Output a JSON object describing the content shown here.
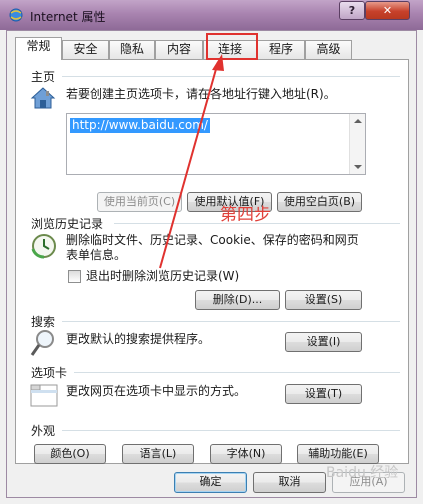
{
  "window": {
    "title": "Internet 属性",
    "help_button": "?",
    "close_button": "✕"
  },
  "tabs": [
    "常规",
    "安全",
    "隐私",
    "内容",
    "连接",
    "程序",
    "高级"
  ],
  "active_tab": "常规",
  "highlighted_tab": "连接",
  "sections": {
    "home": {
      "title": "主页",
      "description": "若要创建主页选项卡，请在各地址行键入地址(R)。",
      "url": "http://www.baidu.com/",
      "buttons": [
        "使用当前页(C)",
        "使用默认值(F)",
        "使用空白页(B)"
      ]
    },
    "history": {
      "title": "浏览历史记录",
      "description_line1": "删除临时文件、历史记录、Cookie、保存的密码和网页",
      "description_line2": "表单信息。",
      "checkbox_label": "退出时删除浏览历史记录(W)",
      "checkbox_checked": false,
      "delete_button": "删除(D)...",
      "settings_button": "设置(S)"
    },
    "search": {
      "title": "搜索",
      "description": "更改默认的搜索提供程序。",
      "settings_button": "设置(I)"
    },
    "tabs_section": {
      "title": "选项卡",
      "description": "更改网页在选项卡中显示的方式。",
      "settings_button": "设置(T)"
    },
    "appearance": {
      "title": "外观",
      "buttons": [
        "颜色(O)",
        "语言(L)",
        "字体(N)",
        "辅助功能(E)"
      ]
    }
  },
  "footer": {
    "ok": "确定",
    "cancel": "取消",
    "apply": "应用(A)"
  },
  "annotation": {
    "step_text": "第四步",
    "watermark": "Baidu 经验",
    "color": "#e0322f"
  }
}
